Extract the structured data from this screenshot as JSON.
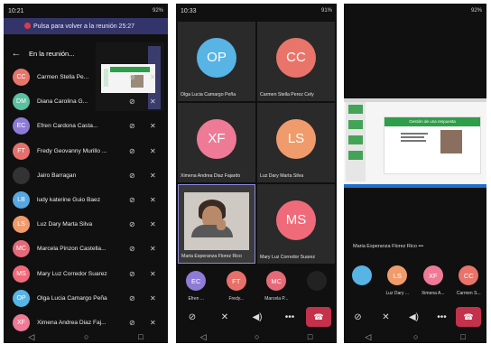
{
  "phone1": {
    "status_time": "10:21",
    "status_icons_left": "⊕ ⊙ ⊗ ⊚",
    "status_right": "92%",
    "banner": "Pulsa para volver a la reunión 25:27",
    "header_title": "En la reunión...",
    "participants": [
      {
        "initials": "CC",
        "name": "Carmen Stella Pe...",
        "color": "#e9746a"
      },
      {
        "initials": "DM",
        "name": "Diana Carolina G...",
        "color": "#5cbf9f"
      },
      {
        "initials": "EC",
        "name": "Efren Cardona Casta...",
        "color": "#8d7bd6"
      },
      {
        "initials": "FT",
        "name": "Fredy Geovanny Murillo ...",
        "color": "#e6706a"
      },
      {
        "initials": "",
        "name": "Jairo Barragan",
        "color": "#333333"
      },
      {
        "initials": "LB",
        "name": "ludy katerine Guio Baez",
        "color": "#58a7e0"
      },
      {
        "initials": "LS",
        "name": "Luz Dary Marta Silva",
        "color": "#f09b6b"
      },
      {
        "initials": "MC",
        "name": "Marcela Pinzon Castella...",
        "color": "#e46a78"
      },
      {
        "initials": "MS",
        "name": "Mary Luz Corredor Suarez",
        "color": "#ef6b7a"
      },
      {
        "initials": "OP",
        "name": "Olga Lucia Camargo Peña",
        "color": "#57b4e5"
      },
      {
        "initials": "XF",
        "name": "Ximena Andrea Diaz Faj...",
        "color": "#ee7a96"
      }
    ]
  },
  "phone2": {
    "status_time": "10:33",
    "status_right": "91%",
    "tiles": [
      {
        "initials": "OP",
        "name": "Olga Lucia Camargo Peña",
        "color": "#57b4e5"
      },
      {
        "initials": "CC",
        "name": "Carmen Stella Perez Cely",
        "color": "#e9746a"
      },
      {
        "initials": "XF",
        "name": "Ximena Andrea Diaz Fajardo",
        "color": "#ee7a96"
      },
      {
        "initials": "LS",
        "name": "Luz Dary Marta Silva",
        "color": "#f09b6b"
      },
      {
        "initials": "",
        "name": "Maria Esperanza Florez Rico",
        "color": "#000000"
      },
      {
        "initials": "MS",
        "name": "Mary Luz Corredor Suarez",
        "color": "#ef6b7a"
      }
    ],
    "mini": [
      {
        "initials": "EC",
        "name": "Efren ...",
        "color": "#8d7bd6"
      },
      {
        "initials": "FT",
        "name": "Fredy...",
        "color": "#e6706a"
      },
      {
        "initials": "MC",
        "name": "Marcela P...",
        "color": "#e46a78"
      },
      {
        "initials": "",
        "name": "",
        "color": "#222222"
      }
    ]
  },
  "phone3": {
    "status_right": "92%",
    "slide_title": "Gestión de una respuesta",
    "presenter": "Maria Esperanza Florez Rico",
    "mini": [
      {
        "initials": "",
        "name": "",
        "color": "#57b4e5"
      },
      {
        "initials": "LS",
        "name": "Luz Dary ...",
        "color": "#f09b6b"
      },
      {
        "initials": "XF",
        "name": "Ximena A...",
        "color": "#ee7a96"
      },
      {
        "initials": "CC",
        "name": "Carmen S...",
        "color": "#e9746a"
      }
    ]
  }
}
